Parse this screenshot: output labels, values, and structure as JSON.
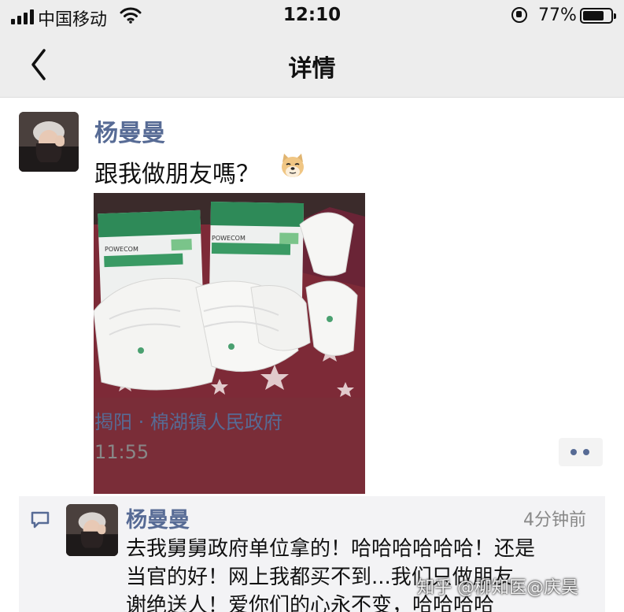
{
  "status_bar": {
    "carrier": "中国移动",
    "time": "12:10",
    "battery_percent": "77%",
    "battery_level": 0.77,
    "icons": [
      "signal-icon",
      "wifi-icon",
      "rotation-lock-icon",
      "battery-icon"
    ]
  },
  "nav": {
    "back_icon": "chevron-left-icon",
    "title": "详情"
  },
  "post": {
    "author": "杨曼曼",
    "text": "跟我做朋友嗎？",
    "emoji": "doge-emoji-icon",
    "photo_labels": [
      "POWECOM",
      "POWECOM"
    ],
    "location": "揭阳 · 棉湖镇人民政府",
    "time": "11:55",
    "more_icon": "more-dots-icon"
  },
  "comment": {
    "icon": "comment-bubble-icon",
    "author": "杨曼曼",
    "time": "4分钟前",
    "lines": [
      "去我舅舅政府单位拿的！哈哈哈哈哈哈！还是",
      "当官的好！网上我都买不到...我们只做朋友",
      "谢绝送人！爱你们的心永不变，哈哈哈哈"
    ]
  },
  "watermark": "知乎 @柳知医@庆昊",
  "colors": {
    "link_blue": "#576b95",
    "nav_bg": "#ededed",
    "comment_bg": "#f3f3f5"
  }
}
